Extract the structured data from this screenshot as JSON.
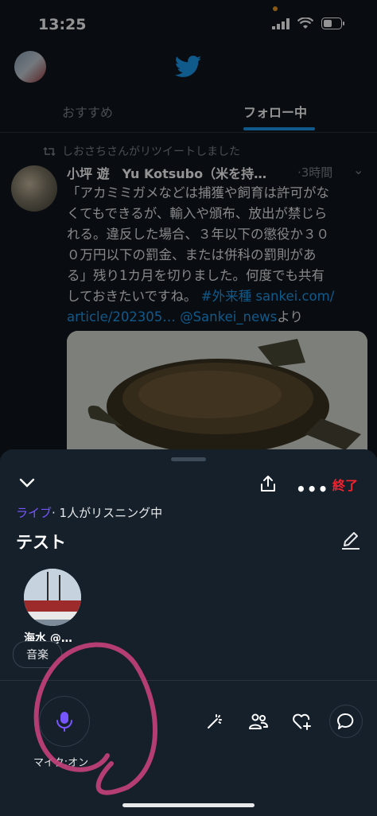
{
  "status_bar": {
    "time": "13:25"
  },
  "header": {
    "icon": "twitter-bird-icon"
  },
  "tabs": [
    {
      "label": "おすすめ"
    },
    {
      "label": "フォロー中"
    }
  ],
  "tweet": {
    "retweet_text": "しおさちさんがリツイートしました",
    "name": "小坪 遊　Yu Kotsubo（米を持…",
    "time": "·3時間",
    "body_lines": [
      "「アカミミガメなどは捕獲や飼育は許可がな",
      "くてもできるが、輸入や頒布、放出が禁じら",
      "れる。違反した場合、３年以下の懲役か３０",
      "０万円以下の罰金、または併科の罰則があ",
      "る」残り1カ月を切りました。何度でも共有",
      "しておきたいですね。"
    ],
    "hashtag": "#外来種",
    "link1": "sankei.com/",
    "link2": "article/202305…",
    "mention": "@Sankei_news",
    "suffix": "より"
  },
  "space": {
    "end_label": "終了",
    "live_label": "ライブ",
    "listening_text": "· 1人がリスニング中",
    "title": "テスト",
    "speaker_name": "海水 @…",
    "topic": "音楽",
    "mic_label": "マイク:オン"
  },
  "colors": {
    "accent_blue": "#1d9bf0",
    "live_purple": "#7856ff",
    "end_red": "#f4212e",
    "annotation_pink": "#c2407a"
  }
}
